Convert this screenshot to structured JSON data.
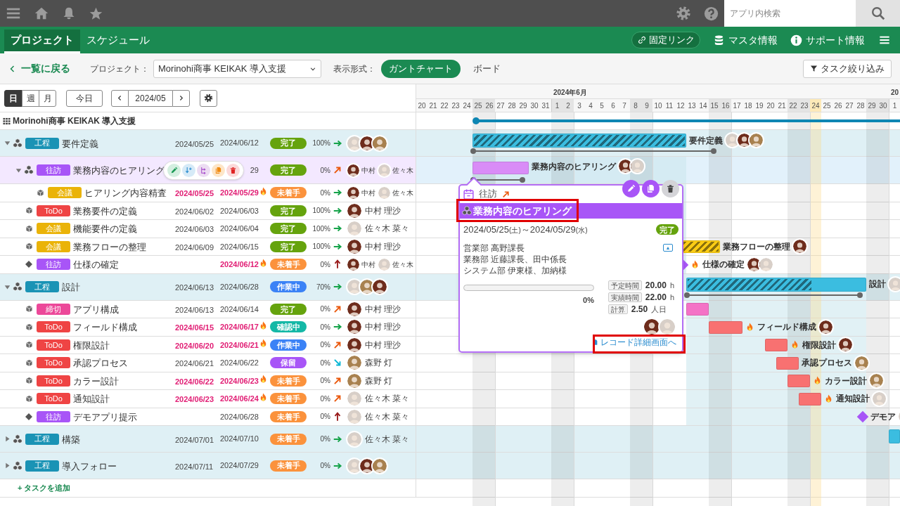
{
  "app_bar": {
    "search": {
      "placeholder": "アプリ内検索"
    }
  },
  "nav": {
    "tabs": [
      {
        "label": "プロジェクト",
        "selected": true
      },
      {
        "label": "スケジュール",
        "selected": false
      }
    ],
    "links": [
      {
        "label": "固定リンク",
        "kind": "pill"
      },
      {
        "label": "マスタ情報",
        "kind": "database"
      },
      {
        "label": "サポート情報",
        "kind": "info"
      }
    ]
  },
  "toolbar": {
    "back": "一覧に戻る",
    "project_label": "プロジェクト：",
    "project": "Morinohi商事 KEIKAK 導入支援",
    "view_label": "表示形式：",
    "views": [
      {
        "label": "ガントチャート",
        "selected": true
      },
      {
        "label": "ボード",
        "selected": false
      }
    ],
    "filter": "タスク絞り込み"
  },
  "controls": {
    "scales": [
      {
        "label": "日",
        "selected": true
      },
      {
        "label": "週",
        "selected": false
      },
      {
        "label": "月",
        "selected": false
      }
    ],
    "today": "今日",
    "period": "2024/05"
  },
  "gantt": {
    "months": [
      "2024年6月",
      "20"
    ],
    "days": [
      {
        "label": "20",
        "weekend": false,
        "today": false,
        "month_start": false
      },
      {
        "label": "21",
        "weekend": false,
        "today": false,
        "month_start": false
      },
      {
        "label": "22",
        "weekend": false,
        "today": false,
        "month_start": false
      },
      {
        "label": "23",
        "weekend": false,
        "today": false,
        "month_start": false
      },
      {
        "label": "24",
        "weekend": false,
        "today": false,
        "month_start": false
      },
      {
        "label": "25",
        "weekend": true,
        "today": false,
        "month_start": false
      },
      {
        "label": "26",
        "weekend": true,
        "today": false,
        "month_start": false
      },
      {
        "label": "27",
        "weekend": false,
        "today": false,
        "month_start": false
      },
      {
        "label": "28",
        "weekend": false,
        "today": false,
        "month_start": false
      },
      {
        "label": "29",
        "weekend": false,
        "today": false,
        "month_start": false
      },
      {
        "label": "30",
        "weekend": false,
        "today": false,
        "month_start": false
      },
      {
        "label": "31",
        "weekend": false,
        "today": false,
        "month_start": false
      },
      {
        "label": "1",
        "weekend": true,
        "today": false,
        "month_start": true
      },
      {
        "label": "2",
        "weekend": true,
        "today": false,
        "month_start": false
      },
      {
        "label": "3",
        "weekend": false,
        "today": false,
        "month_start": false
      },
      {
        "label": "4",
        "weekend": false,
        "today": false,
        "month_start": false
      },
      {
        "label": "5",
        "weekend": false,
        "today": false,
        "month_start": false
      },
      {
        "label": "6",
        "weekend": false,
        "today": false,
        "month_start": false
      },
      {
        "label": "7",
        "weekend": false,
        "today": false,
        "month_start": false
      },
      {
        "label": "8",
        "weekend": true,
        "today": false,
        "month_start": false
      },
      {
        "label": "9",
        "weekend": true,
        "today": false,
        "month_start": false
      },
      {
        "label": "10",
        "weekend": false,
        "today": false,
        "month_start": false
      },
      {
        "label": "11",
        "weekend": false,
        "today": false,
        "month_start": false
      },
      {
        "label": "12",
        "weekend": false,
        "today": false,
        "month_start": false
      },
      {
        "label": "13",
        "weekend": false,
        "today": false,
        "month_start": false
      },
      {
        "label": "14",
        "weekend": false,
        "today": false,
        "month_start": false
      },
      {
        "label": "15",
        "weekend": true,
        "today": false,
        "month_start": false
      },
      {
        "label": "16",
        "weekend": true,
        "today": false,
        "month_start": false
      },
      {
        "label": "17",
        "weekend": false,
        "today": false,
        "month_start": false
      },
      {
        "label": "18",
        "weekend": false,
        "today": false,
        "month_start": false
      },
      {
        "label": "19",
        "weekend": false,
        "today": false,
        "month_start": false
      },
      {
        "label": "20",
        "weekend": false,
        "today": false,
        "month_start": false
      },
      {
        "label": "21",
        "weekend": false,
        "today": false,
        "month_start": false
      },
      {
        "label": "22",
        "weekend": true,
        "today": false,
        "month_start": false
      },
      {
        "label": "23",
        "weekend": true,
        "today": false,
        "month_start": false
      },
      {
        "label": "24",
        "weekend": false,
        "today": true,
        "month_start": false
      },
      {
        "label": "25",
        "weekend": false,
        "today": false,
        "month_start": false
      },
      {
        "label": "26",
        "weekend": false,
        "today": false,
        "month_start": false
      },
      {
        "label": "27",
        "weekend": false,
        "today": false,
        "month_start": false
      },
      {
        "label": "28",
        "weekend": false,
        "today": false,
        "month_start": false
      },
      {
        "label": "29",
        "weekend": true,
        "today": false,
        "month_start": false
      },
      {
        "label": "30",
        "weekend": true,
        "today": false,
        "month_start": false
      },
      {
        "label": "1",
        "weekend": false,
        "today": false,
        "month_start": true
      }
    ]
  },
  "project": {
    "name": "Morinohi商事 KEIKAK 導入支援"
  },
  "rows": [
    {
      "kind": "group",
      "expanded": true,
      "selected": false,
      "tag": {
        "label": "工程",
        "color": "#1a93b5"
      },
      "name": "要件定義",
      "start": "2024/05/25",
      "end": "2024/06/12",
      "overdue": false,
      "status": {
        "label": "完了",
        "color": "#65a30d"
      },
      "progress": "100%",
      "trend": {
        "kind": "flat",
        "color": "#16a34a"
      },
      "assignees": [
        {
          "color": "#d8cfc8"
        },
        {
          "color": "#6e2c1c"
        },
        {
          "color": "#a8814f"
        }
      ],
      "gantt": {
        "color": "#3bbde0",
        "level": 1,
        "label": "要件定義"
      },
      "children": [
        {
          "kind": "parent",
          "expanded": true,
          "selected": true,
          "show_actions": true,
          "tag": {
            "label": "往訪",
            "color": "#a855f7"
          },
          "name": "業務内容のヒアリング",
          "end": "29",
          "overdue": false,
          "status": {
            "label": "完了",
            "color": "#65a30d"
          },
          "progress": "0%",
          "trend": {
            "kind": "rise",
            "color": "#ea580c"
          },
          "assignees": [
            {
              "color": "#6e2c1c",
              "name": "中村"
            },
            {
              "color": "#d8cfc8",
              "name": "佐々木"
            }
          ],
          "gantt": {
            "color": "#d98cf7",
            "label": "業務内容のヒアリング"
          },
          "popup": {
            "category": "往訪",
            "trend": {
              "kind": "rise",
              "color": "#ea580c"
            },
            "title": "業務内容のヒアリング",
            "title_highlighted": true,
            "date_from": "2024/05/25",
            "from_weekday": "(土)",
            "date_separator": "～",
            "date_to": "2024/05/29",
            "to_weekday": "(水)",
            "status": {
              "label": "完了",
              "color": "#65a30d"
            },
            "notes": [
              "営業部 高野課長",
              "業務部 近藤課長、田中係長",
              "システム部 伊東様、加納様"
            ],
            "collapse_symbol": "▲",
            "level": 0,
            "percent": "0%",
            "stats": [
              {
                "label": "予定時間",
                "value": "20.00",
                "unit": "h"
              },
              {
                "label": "実績時間",
                "value": "22.00",
                "unit": "h"
              },
              {
                "label": "計算",
                "value": "2.50",
                "unit": "人日"
              }
            ],
            "assignees": [
              {
                "color": "#6e2c1c"
              },
              {
                "color": "#d8cfc8"
              }
            ],
            "link": "レコード詳細画面へ",
            "link_highlighted": true
          },
          "children": [
            {
              "kind": "task",
              "selected": false,
              "tag": {
                "label": "会議",
                "color": "#eab308"
              },
              "name": "ヒアリング内容精査",
              "start": "2024/05/25",
              "end": "2024/05/29",
              "overdue": true,
              "status": {
                "label": "未着手",
                "color": "#fb923c"
              },
              "progress": "0%",
              "trend": {
                "kind": "flat",
                "color": "#16a34a"
              },
              "assignees": [
                {
                  "color": "#6e2c1c",
                  "name": "中村"
                },
                {
                  "color": "#d8cfc8",
                  "name": "佐々木"
                }
              ]
            }
          ]
        },
        {
          "kind": "task",
          "selected": false,
          "tag": {
            "label": "ToDo",
            "color": "#ef4444"
          },
          "name": "業務要件の定義",
          "start": "2024/06/02",
          "end": "2024/06/03",
          "overdue": false,
          "status": {
            "label": "完了",
            "color": "#65a30d"
          },
          "progress": "100%",
          "trend": {
            "kind": "flat",
            "color": "#16a34a"
          },
          "assignees": [
            {
              "color": "#6e2c1c",
              "name": "中村 理沙"
            }
          ]
        },
        {
          "kind": "task",
          "selected": false,
          "tag": {
            "label": "会議",
            "color": "#eab308"
          },
          "name": "機能要件の定義",
          "start": "2024/06/03",
          "end": "2024/06/04",
          "overdue": false,
          "status": {
            "label": "完了",
            "color": "#65a30d"
          },
          "progress": "100%",
          "trend": {
            "kind": "flat",
            "color": "#16a34a"
          },
          "assignees": [
            {
              "color": "#d8cfc8",
              "name": "佐々木 菜々"
            }
          ]
        },
        {
          "kind": "task",
          "selected": false,
          "tag": {
            "label": "会議",
            "color": "#eab308"
          },
          "name": "業務フローの整理",
          "start": "2024/06/09",
          "end": "2024/06/15",
          "overdue": false,
          "status": {
            "label": "完了",
            "color": "#65a30d"
          },
          "progress": "100%",
          "trend": {
            "kind": "flat",
            "color": "#16a34a"
          },
          "assignees": [
            {
              "color": "#6e2c1c",
              "name": "中村 理沙"
            }
          ],
          "gantt": {
            "color": "#facc15",
            "level": 1,
            "label": "業務フローの整理"
          }
        },
        {
          "kind": "milestone",
          "selected": false,
          "tag": {
            "label": "往訪",
            "color": "#a855f7"
          },
          "name": "仕様の確定",
          "end": "2024/06/12",
          "overdue": true,
          "status": {
            "label": "未着手",
            "color": "#fb923c"
          },
          "progress": "0%",
          "trend": {
            "kind": "up",
            "color": "#991b1b"
          },
          "assignees": [
            {
              "color": "#6e2c1c",
              "name": "中村"
            },
            {
              "color": "#d8cfc8",
              "name": "佐々木"
            }
          ],
          "gantt": {
            "color": "#a855f7",
            "label": "仕様の確定"
          }
        }
      ]
    },
    {
      "kind": "group",
      "expanded": true,
      "selected": false,
      "tag": {
        "label": "工程",
        "color": "#1a93b5"
      },
      "name": "設計",
      "start": "2024/06/13",
      "end": "2024/06/28",
      "overdue": false,
      "status": {
        "label": "作業中",
        "color": "#3b82f6"
      },
      "progress": "70%",
      "trend": {
        "kind": "flat",
        "color": "#16a34a"
      },
      "assignees": [
        {
          "color": "#d8cfc8"
        },
        {
          "color": "#a8814f"
        },
        {
          "color": "#6e2c1c"
        }
      ],
      "gantt": {
        "color": "#3bbde0",
        "level": 0.7,
        "label": "設計"
      },
      "children": [
        {
          "kind": "task",
          "selected": false,
          "tag": {
            "label": "締切",
            "color": "#ec4899"
          },
          "name": "アプリ構成",
          "start": "2024/06/13",
          "end": "2024/06/14",
          "overdue": false,
          "status": {
            "label": "完了",
            "color": "#65a30d"
          },
          "progress": "0%",
          "trend": {
            "kind": "rise",
            "color": "#ea580c"
          },
          "assignees": [
            {
              "color": "#6e2c1c",
              "name": "中村 理沙"
            }
          ],
          "gantt": {
            "color": "#f472c6"
          }
        },
        {
          "kind": "task",
          "selected": false,
          "tag": {
            "label": "ToDo",
            "color": "#ef4444"
          },
          "name": "フィールド構成",
          "start": "2024/06/15",
          "end": "2024/06/17",
          "overdue": true,
          "status": {
            "label": "確認中",
            "color": "#14b8a6"
          },
          "progress": "0%",
          "trend": {
            "kind": "flat",
            "color": "#16a34a"
          },
          "assignees": [
            {
              "color": "#6e2c1c",
              "name": "中村 理沙"
            }
          ],
          "gantt": {
            "color": "#f87171",
            "label": "フィールド構成"
          }
        },
        {
          "kind": "task",
          "selected": false,
          "tag": {
            "label": "ToDo",
            "color": "#ef4444"
          },
          "name": "権限設計",
          "start": "2024/06/20",
          "end": "2024/06/21",
          "overdue": true,
          "status": {
            "label": "作業中",
            "color": "#3b82f6"
          },
          "progress": "0%",
          "trend": {
            "kind": "rise",
            "color": "#ea580c"
          },
          "assignees": [
            {
              "color": "#6e2c1c",
              "name": "中村 理沙"
            }
          ],
          "gantt": {
            "color": "#f87171",
            "label": "権限設計"
          }
        },
        {
          "kind": "task",
          "selected": false,
          "tag": {
            "label": "ToDo",
            "color": "#ef4444"
          },
          "name": "承認プロセス",
          "start": "2024/06/21",
          "end": "2024/06/22",
          "overdue": false,
          "status": {
            "label": "保留",
            "color": "#a855f7"
          },
          "progress": "0%",
          "trend": {
            "kind": "fall",
            "color": "#06b6d4"
          },
          "assignees": [
            {
              "color": "#a8814f",
              "name": "森野 灯"
            }
          ],
          "gantt": {
            "color": "#f87171",
            "label": "承認プロセス"
          }
        },
        {
          "kind": "task",
          "selected": false,
          "tag": {
            "label": "ToDo",
            "color": "#ef4444"
          },
          "name": "カラー設計",
          "start": "2024/06/22",
          "end": "2024/06/23",
          "overdue": true,
          "status": {
            "label": "未着手",
            "color": "#fb923c"
          },
          "progress": "0%",
          "trend": {
            "kind": "rise",
            "color": "#ea580c"
          },
          "assignees": [
            {
              "color": "#a8814f",
              "name": "森野 灯"
            }
          ],
          "gantt": {
            "color": "#f87171",
            "label": "カラー設計"
          }
        },
        {
          "kind": "task",
          "selected": false,
          "tag": {
            "label": "ToDo",
            "color": "#ef4444"
          },
          "name": "通知設計",
          "start": "2024/06/23",
          "end": "2024/06/24",
          "overdue": true,
          "status": {
            "label": "未着手",
            "color": "#fb923c"
          },
          "progress": "0%",
          "trend": {
            "kind": "rise",
            "color": "#ea580c"
          },
          "assignees": [
            {
              "color": "#d8cfc8",
              "name": "佐々木 菜々"
            }
          ],
          "gantt": {
            "color": "#f87171",
            "label": "通知設計"
          }
        },
        {
          "kind": "milestone",
          "selected": false,
          "tag": {
            "label": "往訪",
            "color": "#a855f7"
          },
          "name": "デモアプリ提示",
          "end": "2024/06/28",
          "overdue": false,
          "status": {
            "label": "未着手",
            "color": "#fb923c"
          },
          "progress": "0%",
          "trend": {
            "kind": "up",
            "color": "#991b1b"
          },
          "assignees": [
            {
              "color": "#d8cfc8",
              "name": "佐々木 菜々"
            }
          ],
          "gantt": {
            "color": "#a855f7",
            "label": "デモア"
          }
        }
      ]
    },
    {
      "kind": "group",
      "expanded": false,
      "selected": false,
      "tag": {
        "label": "工程",
        "color": "#1a93b5"
      },
      "name": "構築",
      "start": "2024/07/01",
      "end": "2024/07/10",
      "overdue": false,
      "status": {
        "label": "未着手",
        "color": "#fb923c"
      },
      "progress": "0%",
      "trend": {
        "kind": "flat",
        "color": "#16a34a"
      },
      "assignees": [
        {
          "color": "#d8cfc8",
          "name": "佐々木 菜々"
        }
      ],
      "gantt": {
        "color": "#3bbde0"
      }
    },
    {
      "kind": "group",
      "expanded": false,
      "selected": false,
      "tag": {
        "label": "工程",
        "color": "#1a93b5"
      },
      "name": "導入フォロー",
      "start": "2024/07/11",
      "end": "2024/07/29",
      "overdue": false,
      "status": {
        "label": "未着手",
        "color": "#fb923c"
      },
      "progress": "0%",
      "trend": {
        "kind": "flat",
        "color": "#16a34a"
      },
      "assignees": [
        {
          "color": "#d8cfc8"
        },
        {
          "color": "#6e2c1c"
        },
        {
          "color": "#a8814f"
        }
      ]
    }
  ],
  "add_task": "+ タスクを追加"
}
